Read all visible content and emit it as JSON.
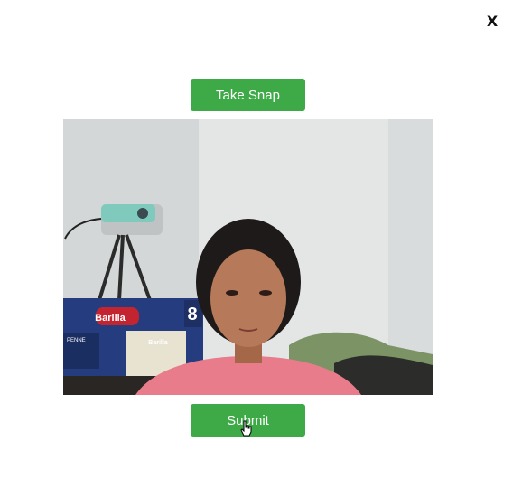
{
  "dialog": {
    "close_label": "X"
  },
  "camera": {
    "take_snap_label": "Take Snap",
    "submit_label": "Submit",
    "feed_icon": "webcam-feed",
    "box_brand_large": "Barilla",
    "box_brand_small": "Barilla",
    "box_variety": "PENNE",
    "box_number": "8"
  },
  "colors": {
    "button_green": "#3daa47",
    "background": "#ffffff",
    "close_text": "#111111"
  }
}
